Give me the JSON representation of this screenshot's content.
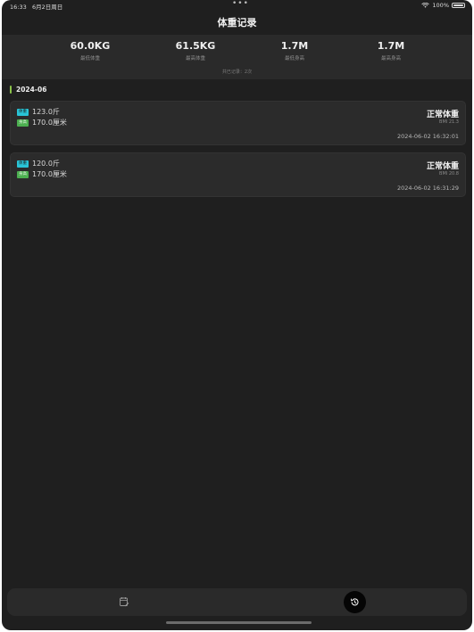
{
  "status_bar": {
    "time": "16:33",
    "date": "6月2日周日",
    "dots": "•••",
    "battery": "100%"
  },
  "nav": {
    "title": "体重记录"
  },
  "stats": [
    {
      "value": "60.0KG",
      "label": "最低体重"
    },
    {
      "value": "61.5KG",
      "label": "最高体重"
    },
    {
      "value": "1.7M",
      "label": "最低身高"
    },
    {
      "value": "1.7M",
      "label": "最高身高"
    }
  ],
  "total_records": "共已记录：2次",
  "section": {
    "title": "2024-06"
  },
  "records": [
    {
      "weight_tag": "体重",
      "weight": "123.0斤",
      "height_tag": "身高",
      "height": "170.0厘米",
      "status": "正常体重",
      "bmi": "BMI 21.3",
      "time": "2024-06-02 16:32:01"
    },
    {
      "weight_tag": "体重",
      "weight": "120.0斤",
      "height_tag": "身高",
      "height": "170.0厘米",
      "status": "正常体重",
      "bmi": "BMI 20.8",
      "time": "2024-06-02 16:31:29"
    }
  ],
  "tabbar": {
    "left_icon": "calendar-edit-icon",
    "right_icon": "history-icon"
  },
  "colors": {
    "background": "#1f1f1f",
    "panel": "#2a2a2a",
    "accent_green": "#8bc34a",
    "weight_tag": "#29c4d6",
    "height_tag": "#4caf50"
  }
}
